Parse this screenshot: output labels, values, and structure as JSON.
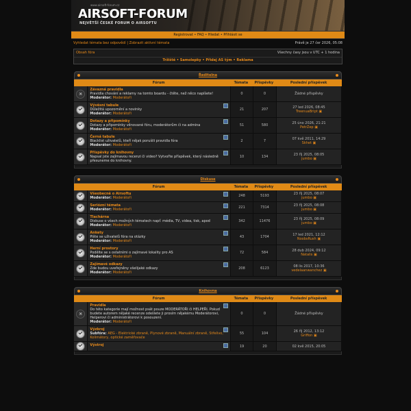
{
  "header": {
    "url": "www.airsoft-forum.cz",
    "logo": "AIRSOFT-FORUM",
    "subtitle": "NEJVĚTŠÍ ČESKÉ FORUM O AIRSOFTU"
  },
  "nav": {
    "register": "Registrovat",
    "faq": "FAQ",
    "search": "Hledat",
    "login": "Přihlásit se",
    "sep": " • "
  },
  "sub": {
    "left": "Vyhledat témata bez odpovědí | Zobrazit aktivní témata",
    "right": "Právě je 27 čer 2026, 05:08"
  },
  "box": {
    "index": "Obsah fóra",
    "tz": "Všechny časy jsou v UTC + 1 hodina",
    "quick": "Tržiště • Samolepky • Přidej AS tým • Reklama"
  },
  "columns": {
    "forum": "Fórum",
    "topics": "Témata",
    "posts": "Příspěvky",
    "last": "Poslední příspěvek"
  },
  "categories": [
    {
      "title": "Ředitelna",
      "forums": [
        {
          "name": "Závazná pravidla",
          "desc": "Pravidla chování a reklamy na tomto boardu - čtěte, než něco napíšete!",
          "modlabel": "Moderátor:",
          "mod": "Moderátoři",
          "topics": "0",
          "posts": "0",
          "last_date": "Žádné příspěvky",
          "last_user": "",
          "locked": true,
          "feed": false
        },
        {
          "name": "Vývěsní tabule",
          "desc": "Důležitá upozornění a novinky",
          "modlabel": "Moderátor:",
          "mod": "Moderátoři",
          "topics": "21",
          "posts": "207",
          "last_date": "27 led 2026, 08:45",
          "last_user": "TreenuaBript",
          "locked": false,
          "feed": true
        },
        {
          "name": "Dotazy a připomínky",
          "desc": "Dotazy a připomínky věnované fóru, moderátorům či na admina",
          "modlabel": "Moderátor:",
          "mod": "Moderátoři",
          "topics": "51",
          "posts": "580",
          "last_date": "25 úno 2026, 21:21",
          "last_user": "PetrZep",
          "locked": false,
          "feed": true
        },
        {
          "name": "Černá tabule",
          "desc": "Blacklist uživatelů, kteří nějak porušili pravidla fóra",
          "modlabel": "Moderátor:",
          "mod": "Moderátoři",
          "topics": "2",
          "posts": "7",
          "last_date": "07 kvě 2011, 14:29",
          "last_user": "Skhet",
          "locked": false,
          "feed": true
        },
        {
          "name": "Příspěvky do knihovny",
          "desc": "Napsal jste zajímavou recenzi či video? Vytvořte příspěvek, který následně přesuneme do knihovny.",
          "modlabel": "",
          "mod": "",
          "topics": "10",
          "posts": "134",
          "last_date": "23 říj 2025, 08:05",
          "last_user": "jumbo",
          "locked": false,
          "feed": true
        }
      ]
    },
    {
      "title": "Diskuse",
      "forums": [
        {
          "name": "Všeobecně o Airsoftu",
          "desc": "",
          "modlabel": "Moderátor:",
          "mod": "Moderátoři",
          "topics": "248",
          "posts": "5193",
          "last_date": "23 říj 2025, 08:07",
          "last_user": "jumbo",
          "locked": false,
          "feed": true
        },
        {
          "name": "Seriózní témata",
          "desc": "",
          "modlabel": "Moderátor:",
          "mod": "Moderátoři",
          "topics": "221",
          "posts": "7314",
          "last_date": "23 říj 2025, 08:08",
          "last_user": "jumbo",
          "locked": false,
          "feed": true
        },
        {
          "name": "Tlachárna",
          "desc": "Diskuse o všech možných tématech např. média, TV, videa, tisk, apod",
          "modlabel": "Moderátor:",
          "mod": "Moderátoři",
          "topics": "342",
          "posts": "11476",
          "last_date": "23 říj 2025, 08:09",
          "last_user": "jumbo",
          "locked": false,
          "feed": true
        },
        {
          "name": "Ankety",
          "desc": "Pište se uživatelů fóra na otázky",
          "modlabel": "Moderátor:",
          "mod": "Moderátoři",
          "topics": "43",
          "posts": "1704",
          "last_date": "17 led 2021, 12:12",
          "last_user": "NoobsRush",
          "locked": false,
          "feed": true
        },
        {
          "name": "Herní prostory",
          "desc": "Podělte se s ostatními o zajímavé lokality pro AS",
          "modlabel": "Moderátor:",
          "mod": "Moderátoři",
          "topics": "72",
          "posts": "584",
          "last_date": "28 dub 2024, 09:12",
          "last_user": "Natalis",
          "locked": false,
          "feed": true
        },
        {
          "name": "Zajímavé odkazy",
          "desc": "Zde budou uveřejněny všelijaké odkazy",
          "modlabel": "Moderátor:",
          "mod": "Moderátoři",
          "topics": "208",
          "posts": "6123",
          "last_date": "08 lis 2017, 10:36",
          "last_user": "vedelaanwanchez",
          "locked": false,
          "feed": true
        }
      ]
    },
    {
      "title": "Knihovna",
      "forums": [
        {
          "name": "Pravidla",
          "desc": "Do této kategorie mají možnost psát pouze MODERÁTOŘI či HELPEŘI. Pokud budete autorem nějaké recenze odešlete ji prosím nějakému Moderátorovi, Helperovi či administrátorovi k posouzení.",
          "modlabel": "Moderátor:",
          "mod": "Moderátoři",
          "topics": "0",
          "posts": "0",
          "last_date": "Žádné příspěvky",
          "last_user": "",
          "locked": true,
          "feed": true
        },
        {
          "name": "Výzbroj",
          "desc": "",
          "modlabel": "Subfóra:",
          "mod": "AEG - Elektrické zbraně, Plynové zbraně, Manuální zbraně, Střelivo, Kolimátory, optické zaměřovače",
          "topics": "55",
          "posts": "104",
          "last_date": "26 říj 2012, 13:12",
          "last_user": "Griffon",
          "locked": false,
          "feed": true
        },
        {
          "name": "Výstroj",
          "desc": "",
          "modlabel": "",
          "mod": "",
          "topics": "19",
          "posts": "20",
          "last_date": "02 kvě 2015, 20:05",
          "last_user": "",
          "locked": false,
          "feed": true
        }
      ]
    }
  ]
}
